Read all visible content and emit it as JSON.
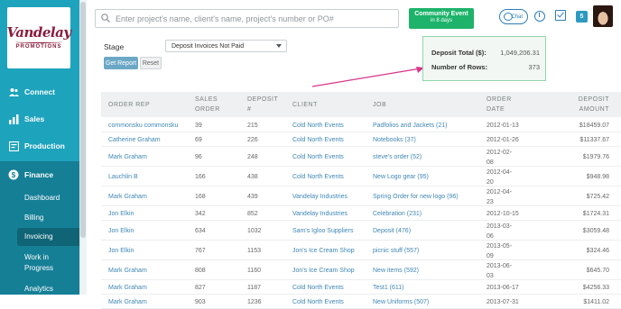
{
  "logo": {
    "name": "Vandelay",
    "sub": "PROMOTIONS"
  },
  "sidebar": {
    "items": [
      {
        "label": "Connect",
        "icon": "connect-icon"
      },
      {
        "label": "Sales",
        "icon": "bar-chart-icon"
      },
      {
        "label": "Production",
        "icon": "production-icon"
      },
      {
        "label": "Finance",
        "icon": "dollar-icon"
      }
    ],
    "finance_sub": [
      "Dashboard",
      "Billing",
      "Invoicing",
      "Work in Progress",
      "Analytics"
    ],
    "active_sub": "Invoicing"
  },
  "search": {
    "placeholder": "Enter project's name, client's name, project's number or PO#"
  },
  "event": {
    "title": "Community Event",
    "subtitle": "in 8 days"
  },
  "chat": {
    "label": "Chat"
  },
  "notification_count": "5",
  "stage": {
    "label": "Stage",
    "selected": "Deposit Invoices Not Paid"
  },
  "buttons": {
    "report": "Get Report",
    "reset": "Reset"
  },
  "summary": {
    "total_label": "Deposit Total ($):",
    "total_value": "1,049,206.31",
    "rows_label": "Number of Rows:",
    "rows_value": "373"
  },
  "table": {
    "headers": {
      "rep": "ORDER REP",
      "sales1": "SALES",
      "sales2": "ORDER",
      "dep1": "DEPOSIT",
      "dep2": "#",
      "client": "CLIENT",
      "job": "JOB",
      "date1": "ORDER",
      "date2": "DATE",
      "amt1": "DEPOSIT",
      "amt2": "AMOUNT"
    },
    "rows": [
      {
        "rep": "commonsku commonsku",
        "so": "39",
        "dep": "215",
        "client": "Cold North Events",
        "job": "Padfolios and Jackets (21)",
        "date1": "2012-01-13",
        "date2": "",
        "amt": "$18459.07"
      },
      {
        "rep": "Catherine Graham",
        "so": "69",
        "dep": "226",
        "client": "Cold North Events",
        "job": "Notebooks (37)",
        "date1": "2012-01-26",
        "date2": "",
        "amt": "$11337.67"
      },
      {
        "rep": "Mark Graham",
        "so": "96",
        "dep": "248",
        "client": "Cold North Events",
        "job": "steve's order (52)",
        "date1": "2012-02-",
        "date2": "08",
        "amt": "$1979.76"
      },
      {
        "rep": "Lauchlin B",
        "so": "166",
        "dep": "438",
        "client": "Cold North Events",
        "job": "New Logo gear (95)",
        "date1": "2012-04-",
        "date2": "20",
        "amt": "$948.98"
      },
      {
        "rep": "Mark Graham",
        "so": "168",
        "dep": "439",
        "client": "Vandelay Industries",
        "job": "Spring Order for new logo (96)",
        "date1": "2012-04-",
        "date2": "23",
        "amt": "$725.42"
      },
      {
        "rep": "Jon Elkin",
        "so": "342",
        "dep": "852",
        "client": "Vandelay Industries",
        "job": "Celebration (231)",
        "date1": "2012-10-15",
        "date2": "",
        "amt": "$1724.31"
      },
      {
        "rep": "Jon Elkin",
        "so": "634",
        "dep": "1032",
        "client": "Sam's Igloo Suppliers",
        "job": "Deposit (476)",
        "date1": "2013-03-",
        "date2": "06",
        "amt": "$3059.48"
      },
      {
        "rep": "Jon Elkin",
        "so": "767",
        "dep": "1153",
        "client": "Jon's Ice Cream Shop",
        "job": "picnic stuff (557)",
        "date1": "2013-05-",
        "date2": "09",
        "amt": "$324.46"
      },
      {
        "rep": "Mark Graham",
        "so": "808",
        "dep": "1160",
        "client": "Jon's Ice Cream Shop",
        "job": "New items (592)",
        "date1": "2013-06-",
        "date2": "03",
        "amt": "$645.70"
      },
      {
        "rep": "Mark Graham",
        "so": "827",
        "dep": "1187",
        "client": "Cold North Events",
        "job": "Test1 (611)",
        "date1": "2013-06-17",
        "date2": "",
        "amt": "$4256.33"
      },
      {
        "rep": "Mark Graham",
        "so": "903",
        "dep": "1236",
        "client": "Cold North Events",
        "job": "New Uniforms (507)",
        "date1": "2013-07-31",
        "date2": "",
        "amt": "$1411.02"
      }
    ]
  },
  "colors": {
    "sidebar": "#1ea3bd",
    "finance": "#157f96",
    "accent": "#1db36a",
    "link": "#3f87b5"
  }
}
